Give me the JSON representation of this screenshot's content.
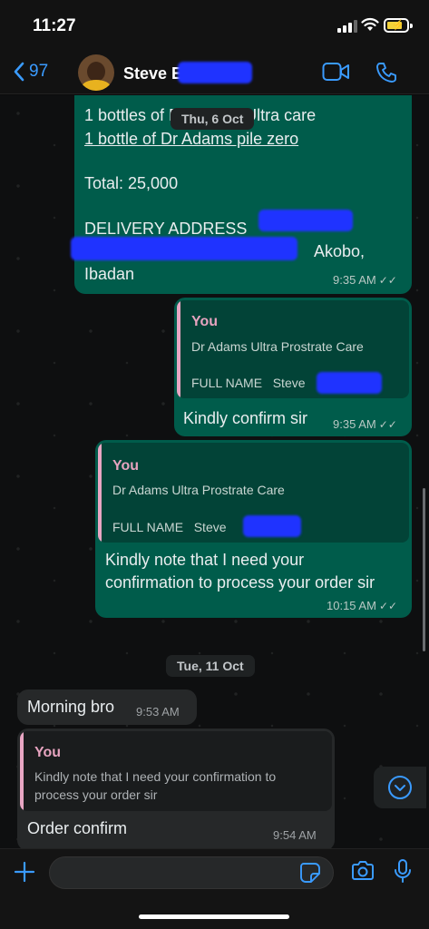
{
  "status_bar": {
    "time": "11:27"
  },
  "header": {
    "back_count": "97",
    "contact_name": "Steve E"
  },
  "messages": {
    "m1": {
      "lines": [
        "1 bottles of Dr Adams Ultra care",
        "1 bottle of Dr Adams pile zero",
        "Total: 25,000",
        "DELIVERY ADDRESS",
        "Akobo,",
        "Ibadan"
      ],
      "time": "9:35 AM"
    },
    "m2": {
      "quote_author": "You",
      "quote_line1": "Dr Adams Ultra Prostrate Care",
      "quote_line2": "FULL NAME   Steve",
      "text": "Kindly confirm sir",
      "time": "9:35 AM"
    },
    "m3": {
      "quote_author": "You",
      "quote_line1": "Dr Adams Ultra Prostrate Care",
      "quote_line2": "FULL NAME   Steve",
      "text_line1": "Kindly note that I need your",
      "text_line2": "confirmation to process your order sir",
      "time": "10:15 AM"
    },
    "m4": {
      "text": "Morning bro",
      "time": "9:53 AM"
    },
    "m5": {
      "quote_author": "You",
      "quote_line1": "Kindly note that I need your confirmation to",
      "quote_line2": "process your order sir",
      "text": "Order confirm",
      "time": "9:54 AM"
    }
  },
  "date_chips": {
    "floating": "Thu, 6 Oct",
    "divider": "Tue, 11 Oct"
  },
  "composer": {
    "value": "",
    "placeholder": ""
  },
  "colors": {
    "accent": "#3a9bff",
    "outgoing_bubble": "#005c4b",
    "incoming_bubble": "#262829",
    "quote_name": "#e6a3bf"
  }
}
